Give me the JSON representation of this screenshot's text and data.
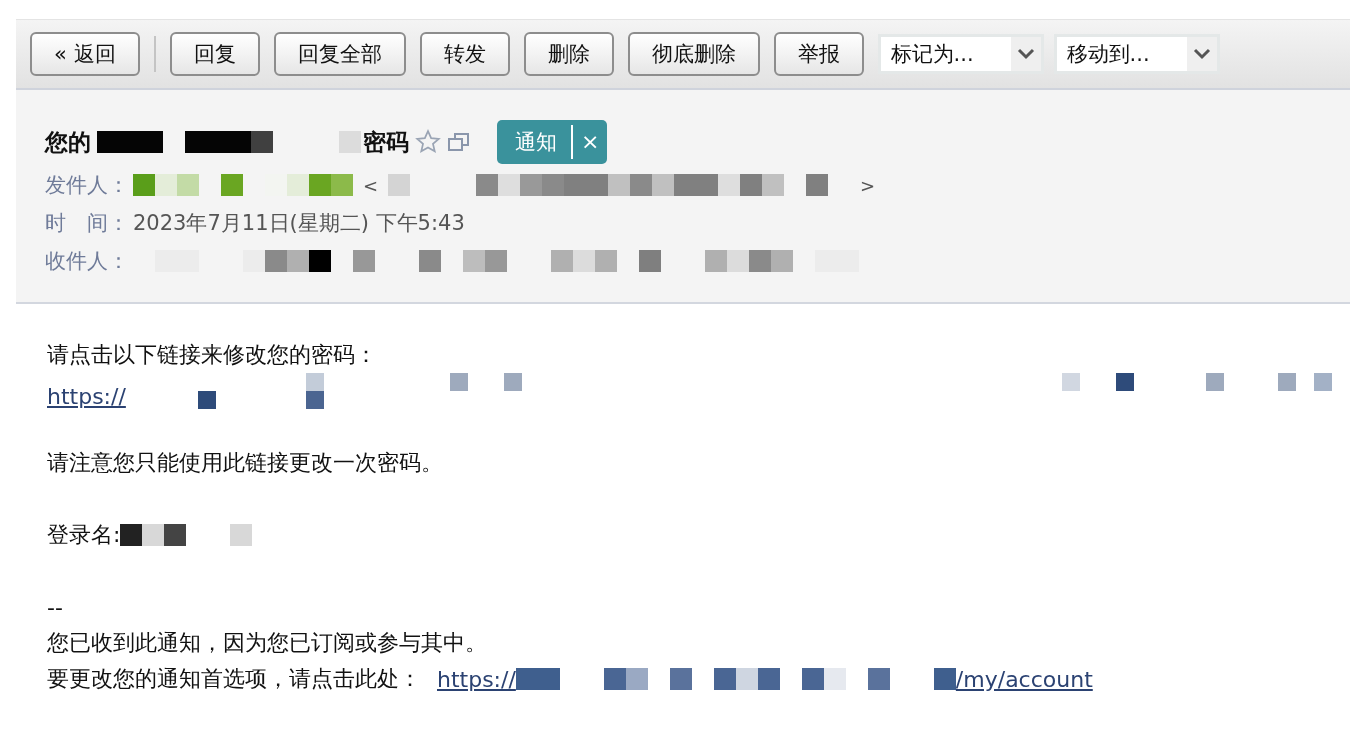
{
  "toolbar": {
    "back": "« 返回",
    "buttons": [
      "回复",
      "回复全部",
      "转发",
      "删除",
      "彻底删除",
      "举报"
    ],
    "selects": [
      {
        "value": "标记为..."
      },
      {
        "value": "移动到..."
      }
    ]
  },
  "header": {
    "subject_start": "您的",
    "subject_end": "密码",
    "starred": false,
    "tag": {
      "label": "通知",
      "close": "×",
      "color": "#3a929c"
    },
    "sender": {
      "label": "发件人：",
      "open": "<",
      "close": ">"
    },
    "time": {
      "label": "时　间：",
      "value": "2023年7月11日(星期二) 下午5:43"
    },
    "recipient": {
      "label": "收件人："
    }
  },
  "body": {
    "intro": "请点击以下链接来修改您的密码：",
    "link_start": "https://",
    "note": "请注意您只能使用此链接更改一次密码。",
    "login_label": "登录名:",
    "signature": "--",
    "footer_line": "您已收到此通知，因为您已订阅或参与其中。",
    "footer_prompt": "要更改您的通知首选项，请点击此处：",
    "footer_link_start": "https://",
    "footer_link_end": "/my/account"
  }
}
